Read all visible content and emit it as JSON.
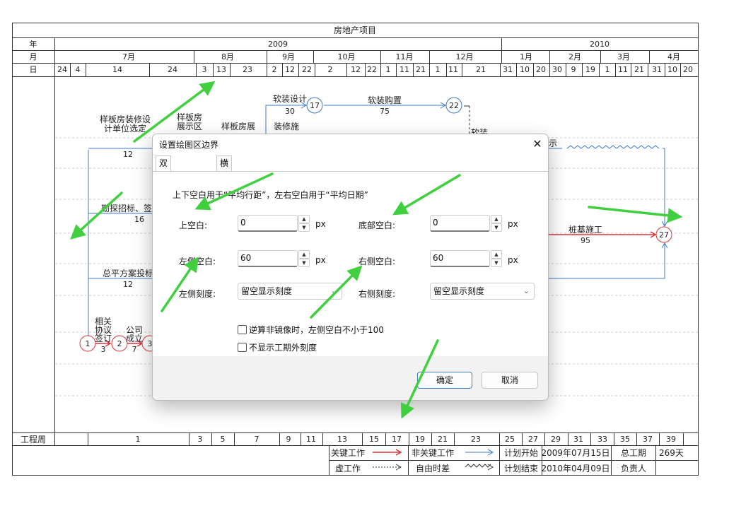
{
  "chart": {
    "title": "房地产项目",
    "row_labels": {
      "year": "年",
      "month": "月",
      "day": "日",
      "week": "工程周"
    },
    "years": [
      "2009",
      "2010"
    ],
    "months": [
      "7月",
      "8月",
      "9月",
      "10月",
      "11月",
      "12月",
      "1月",
      "2月",
      "3月",
      "4月"
    ],
    "days": [
      "24",
      "4",
      "14",
      "24",
      "3",
      "13",
      "23",
      "2",
      "12",
      "22",
      "2",
      "12",
      "22",
      "1",
      "11",
      "21",
      "1",
      "11",
      "21",
      "31",
      "10",
      "20",
      "30",
      "9",
      "19",
      "1",
      "11",
      "21",
      "31",
      "10",
      "20"
    ],
    "weeks": [
      "1",
      "3",
      "5",
      "7",
      "9",
      "11",
      "13",
      "15",
      "17",
      "19",
      "21",
      "23",
      "25",
      "27",
      "29",
      "31",
      "33",
      "35",
      "37",
      "39"
    ],
    "tasks": [
      {
        "name": "样板房装修设计单位选定",
        "line1": "样板房装修设",
        "line2": "计单位选定",
        "duration": "12"
      },
      {
        "name": "样板房展示区",
        "line1": "样板房",
        "line2": "展示区",
        "duration": ""
      },
      {
        "name": "样板房展",
        "line1": "样板房展",
        "duration": ""
      },
      {
        "name": "软装设计",
        "duration": "30"
      },
      {
        "name": "软装购置",
        "duration": "75"
      },
      {
        "name": "装修施",
        "duration": ""
      },
      {
        "name": "软装",
        "duration": ""
      },
      {
        "name": "示",
        "duration": ""
      },
      {
        "name": "勘探招标、签",
        "duration": "16"
      },
      {
        "name": "总平方案投标",
        "duration": "12"
      },
      {
        "name": "桩基施工",
        "duration": "95"
      },
      {
        "name": "相关协议签订",
        "line1": "相关",
        "line2": "协议",
        "line3": "签订",
        "duration": "3"
      },
      {
        "name": "公司成立",
        "line1": "公司",
        "line2": "成立",
        "duration": "7"
      }
    ],
    "nodes": [
      "1",
      "2",
      "3",
      "17",
      "22",
      "27"
    ],
    "legend": {
      "critical": "关键工作",
      "noncritical": "非关键工作",
      "plan_start_label": "计划开始",
      "plan_start": "2009年07月15日",
      "total_label": "总工期",
      "total": "269天",
      "virtual": "虚工作",
      "float": "自由时差",
      "plan_end_label": "计划结束",
      "plan_end": "2010年04月09日",
      "owner_label": "负责人",
      "owner": ""
    },
    "colors": {
      "critical": "#d9363e",
      "noncritical": "#3c78c8",
      "annotation_arrow": "#3fcf3f"
    }
  },
  "dialog": {
    "title": "设置绘图区边界",
    "close_icon": "close-icon",
    "tabs": [
      "双代号网络图",
      "横道图"
    ],
    "active_tab": 0,
    "hint": "上下空白用于“平均行距”，左右空白用于“平均日期”",
    "top_label": "上空白:",
    "top_value": "0",
    "bottom_label": "底部空白:",
    "bottom_value": "0",
    "left_label": "左侧空白:",
    "left_value": "60",
    "right_label": "右侧空白:",
    "right_value": "60",
    "unit": "px",
    "left_scale_label": "左侧刻度:",
    "left_scale_value": "留空显示刻度",
    "right_scale_label": "右侧刻度:",
    "right_scale_value": "留空显示刻度",
    "check1": "逆算非镜像时，左侧空白不小于100",
    "check2": "不显示工期外刻度",
    "ok": "确定",
    "cancel": "取消"
  }
}
